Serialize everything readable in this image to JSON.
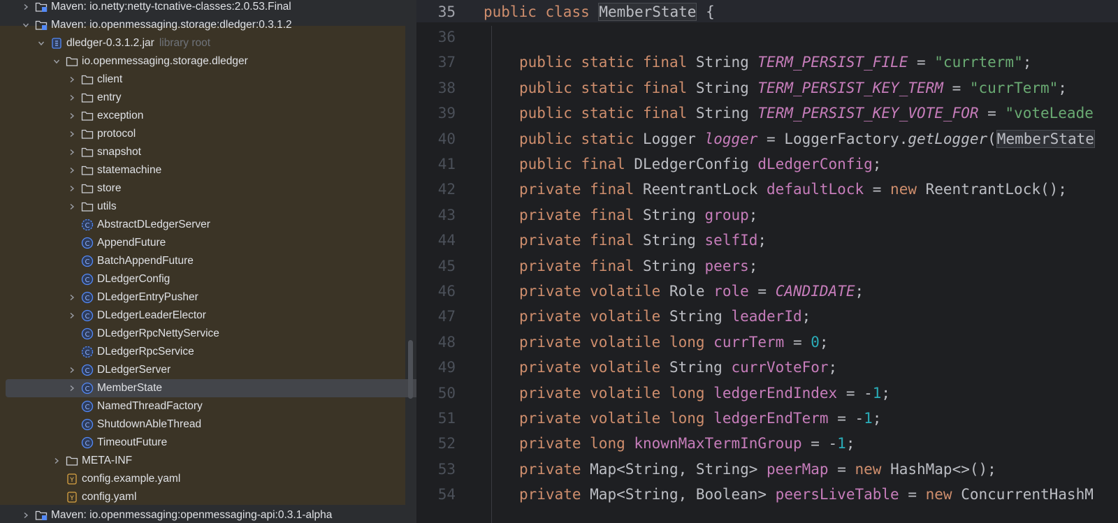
{
  "project_tree": {
    "rows": [
      {
        "label": "Maven: io.netty:netty-tcnative-classes:2.0.53.Final",
        "icon": "maven-library-icon",
        "expanded": false
      },
      {
        "label": "Maven: io.openmessaging.storage:dledger:0.3.1.2",
        "icon": "maven-library-icon",
        "expanded": true
      },
      {
        "label": "dledger-0.3.1.2.jar",
        "hint": "library root",
        "icon": "jar-icon",
        "expanded": true
      },
      {
        "label": "io.openmessaging.storage.dledger",
        "icon": "folder-icon",
        "expanded": true
      },
      {
        "label": "client",
        "icon": "folder-icon"
      },
      {
        "label": "entry",
        "icon": "folder-icon"
      },
      {
        "label": "exception",
        "icon": "folder-icon"
      },
      {
        "label": "protocol",
        "icon": "folder-icon"
      },
      {
        "label": "snapshot",
        "icon": "folder-icon"
      },
      {
        "label": "statemachine",
        "icon": "folder-icon"
      },
      {
        "label": "store",
        "icon": "folder-icon"
      },
      {
        "label": "utils",
        "icon": "folder-icon"
      },
      {
        "label": "AbstractDLedgerServer",
        "icon": "abstract-class-icon"
      },
      {
        "label": "AppendFuture",
        "icon": "class-icon"
      },
      {
        "label": "BatchAppendFuture",
        "icon": "class-icon"
      },
      {
        "label": "DLedgerConfig",
        "icon": "class-icon"
      },
      {
        "label": "DLedgerEntryPusher",
        "icon": "class-icon"
      },
      {
        "label": "DLedgerLeaderElector",
        "icon": "class-icon"
      },
      {
        "label": "DLedgerRpcNettyService",
        "icon": "class-icon"
      },
      {
        "label": "DLedgerRpcService",
        "icon": "abstract-class-icon"
      },
      {
        "label": "DLedgerServer",
        "icon": "class-icon"
      },
      {
        "label": "MemberState",
        "icon": "class-icon",
        "selected": true
      },
      {
        "label": "NamedThreadFactory",
        "icon": "class-icon"
      },
      {
        "label": "ShutdownAbleThread",
        "icon": "class-icon"
      },
      {
        "label": "TimeoutFuture",
        "icon": "class-icon"
      },
      {
        "label": "META-INF",
        "icon": "folder-icon"
      },
      {
        "label": "config.example.yaml",
        "icon": "yaml-file-icon"
      },
      {
        "label": "config.yaml",
        "icon": "yaml-file-icon"
      },
      {
        "label": "Maven: io.openmessaging:openmessaging-api:0.3.1-alpha",
        "icon": "maven-library-icon",
        "expanded": false
      }
    ]
  },
  "editor": {
    "lines": [
      {
        "n": "35",
        "current": true,
        "tokens": [
          [
            "kw",
            "public "
          ],
          [
            "kw",
            "class "
          ],
          [
            "hlbox",
            "MemberState"
          ],
          [
            "p",
            " {"
          ]
        ]
      },
      {
        "n": "36",
        "tokens": []
      },
      {
        "n": "37",
        "tokens": [
          [
            "kw",
            "public "
          ],
          [
            "kw",
            "static "
          ],
          [
            "kw",
            "final "
          ],
          [
            "p",
            "String "
          ],
          [
            "sfld",
            "TERM_PERSIST_FILE"
          ],
          [
            "p",
            " = "
          ],
          [
            "str",
            "\"currterm\""
          ],
          [
            "p",
            ";"
          ]
        ]
      },
      {
        "n": "38",
        "tokens": [
          [
            "kw",
            "public "
          ],
          [
            "kw",
            "static "
          ],
          [
            "kw",
            "final "
          ],
          [
            "p",
            "String "
          ],
          [
            "sfld",
            "TERM_PERSIST_KEY_TERM"
          ],
          [
            "p",
            " = "
          ],
          [
            "str",
            "\"currTerm\""
          ],
          [
            "p",
            ";"
          ]
        ]
      },
      {
        "n": "39",
        "tokens": [
          [
            "kw",
            "public "
          ],
          [
            "kw",
            "static "
          ],
          [
            "kw",
            "final "
          ],
          [
            "p",
            "String "
          ],
          [
            "sfld",
            "TERM_PERSIST_KEY_VOTE_FOR"
          ],
          [
            "p",
            " = "
          ],
          [
            "str",
            "\"voteLeade"
          ]
        ]
      },
      {
        "n": "40",
        "tokens": [
          [
            "kw",
            "public "
          ],
          [
            "kw",
            "static "
          ],
          [
            "p",
            "Logger "
          ],
          [
            "sfld",
            "logger"
          ],
          [
            "p",
            " = LoggerFactory."
          ],
          [
            "mcall",
            "getLogger"
          ],
          [
            "p",
            "("
          ],
          [
            "hlbox",
            "MemberState"
          ]
        ]
      },
      {
        "n": "41",
        "tokens": [
          [
            "kw",
            "public "
          ],
          [
            "kw",
            "final "
          ],
          [
            "p",
            "DLedgerConfig "
          ],
          [
            "fld",
            "dLedgerConfig"
          ],
          [
            "p",
            ";"
          ]
        ]
      },
      {
        "n": "42",
        "tokens": [
          [
            "kw",
            "private "
          ],
          [
            "kw",
            "final "
          ],
          [
            "p",
            "ReentrantLock "
          ],
          [
            "fld",
            "defaultLock"
          ],
          [
            "p",
            " = "
          ],
          [
            "kw",
            "new "
          ],
          [
            "p",
            "ReentrantLock();"
          ]
        ]
      },
      {
        "n": "43",
        "tokens": [
          [
            "kw",
            "private "
          ],
          [
            "kw",
            "final "
          ],
          [
            "p",
            "String "
          ],
          [
            "fld",
            "group"
          ],
          [
            "p",
            ";"
          ]
        ]
      },
      {
        "n": "44",
        "tokens": [
          [
            "kw",
            "private "
          ],
          [
            "kw",
            "final "
          ],
          [
            "p",
            "String "
          ],
          [
            "fld",
            "selfId"
          ],
          [
            "p",
            ";"
          ]
        ]
      },
      {
        "n": "45",
        "tokens": [
          [
            "kw",
            "private "
          ],
          [
            "kw",
            "final "
          ],
          [
            "p",
            "String "
          ],
          [
            "fld",
            "peers"
          ],
          [
            "p",
            ";"
          ]
        ]
      },
      {
        "n": "46",
        "tokens": [
          [
            "kw",
            "private "
          ],
          [
            "kw",
            "volatile "
          ],
          [
            "p",
            "Role "
          ],
          [
            "fld",
            "role"
          ],
          [
            "p",
            " = "
          ],
          [
            "sfld",
            "CANDIDATE"
          ],
          [
            "p",
            ";"
          ]
        ]
      },
      {
        "n": "47",
        "tokens": [
          [
            "kw",
            "private "
          ],
          [
            "kw",
            "volatile "
          ],
          [
            "p",
            "String "
          ],
          [
            "fld",
            "leaderId"
          ],
          [
            "p",
            ";"
          ]
        ]
      },
      {
        "n": "48",
        "tokens": [
          [
            "kw",
            "private "
          ],
          [
            "kw",
            "volatile "
          ],
          [
            "kw",
            "long "
          ],
          [
            "fld",
            "currTerm"
          ],
          [
            "p",
            " = "
          ],
          [
            "num",
            "0"
          ],
          [
            "p",
            ";"
          ]
        ]
      },
      {
        "n": "49",
        "tokens": [
          [
            "kw",
            "private "
          ],
          [
            "kw",
            "volatile "
          ],
          [
            "p",
            "String "
          ],
          [
            "fld",
            "currVoteFor"
          ],
          [
            "p",
            ";"
          ]
        ]
      },
      {
        "n": "50",
        "tokens": [
          [
            "kw",
            "private "
          ],
          [
            "kw",
            "volatile "
          ],
          [
            "kw",
            "long "
          ],
          [
            "fld",
            "ledgerEndIndex"
          ],
          [
            "p",
            " = -"
          ],
          [
            "num",
            "1"
          ],
          [
            "p",
            ";"
          ]
        ]
      },
      {
        "n": "51",
        "tokens": [
          [
            "kw",
            "private "
          ],
          [
            "kw",
            "volatile "
          ],
          [
            "kw",
            "long "
          ],
          [
            "fld",
            "ledgerEndTerm"
          ],
          [
            "p",
            " = -"
          ],
          [
            "num",
            "1"
          ],
          [
            "p",
            ";"
          ]
        ]
      },
      {
        "n": "52",
        "tokens": [
          [
            "kw",
            "private "
          ],
          [
            "kw",
            "long "
          ],
          [
            "fld",
            "knownMaxTermInGroup"
          ],
          [
            "p",
            " = -"
          ],
          [
            "num",
            "1"
          ],
          [
            "p",
            ";"
          ]
        ]
      },
      {
        "n": "53",
        "tokens": [
          [
            "kw",
            "private "
          ],
          [
            "p",
            "Map<String, String> "
          ],
          [
            "fld",
            "peerMap"
          ],
          [
            "p",
            " = "
          ],
          [
            "kw",
            "new "
          ],
          [
            "p",
            "HashMap<>();"
          ]
        ]
      },
      {
        "n": "54",
        "tokens": [
          [
            "kw",
            "private "
          ],
          [
            "p",
            "Map<String, Boolean> "
          ],
          [
            "fld",
            "peersLiveTable"
          ],
          [
            "p",
            " = "
          ],
          [
            "kw",
            "new "
          ],
          [
            "p",
            "ConcurrentHashM"
          ]
        ]
      }
    ]
  },
  "colors": {
    "keyword": "#cf8e6d",
    "field": "#c77dbb",
    "string": "#6aab73",
    "number": "#2aacb8",
    "text": "#bcbec4",
    "library_bg": "#3b3426"
  }
}
